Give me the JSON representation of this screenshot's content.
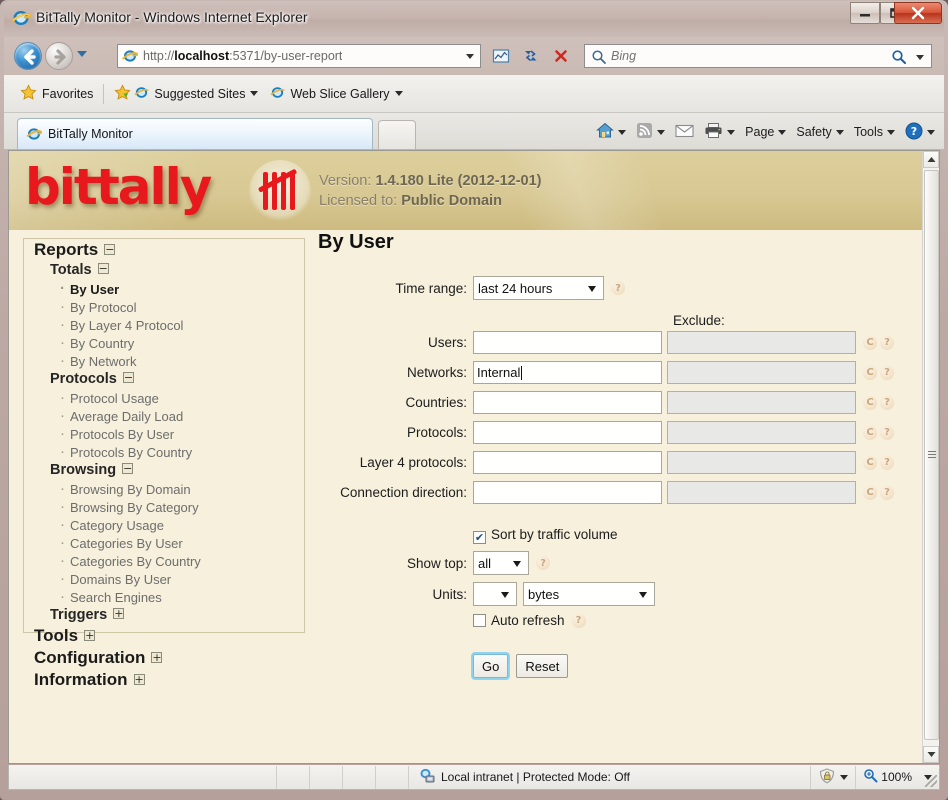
{
  "window": {
    "title": "BitTally Monitor - Windows Internet Explorer",
    "minimize_label": "Minimize",
    "maximize_label": "Maximize",
    "close_label": "Close"
  },
  "browser": {
    "url_prefix": "http://",
    "url_host": "localhost",
    "url_rest": ":5371/by-user-report",
    "search_placeholder": "Bing",
    "favorites_label": "Favorites",
    "suggested_sites_label": "Suggested Sites",
    "web_slice_label": "Web Slice Gallery",
    "tab_label": "BitTally Monitor",
    "commands": [
      {
        "label": "Page"
      },
      {
        "label": "Safety"
      },
      {
        "label": "Tools"
      }
    ]
  },
  "banner": {
    "logo": "bittally",
    "version_label": "Version:",
    "version_value": "1.4.180 Lite (2012-12-01)",
    "licensed_label": "Licensed to:",
    "licensed_value": "Public Domain"
  },
  "sidebar": {
    "groups": [
      {
        "label": "Reports",
        "toggle": "−",
        "subgroups": [
          {
            "label": "Totals",
            "toggle": "−",
            "items": [
              {
                "label": "By User",
                "active": true
              },
              {
                "label": "By Protocol",
                "active": false
              },
              {
                "label": "By Layer 4 Protocol",
                "active": false
              },
              {
                "label": "By Country",
                "active": false
              },
              {
                "label": "By Network",
                "active": false
              }
            ]
          },
          {
            "label": "Protocols",
            "toggle": "−",
            "items": [
              {
                "label": "Protocol Usage",
                "active": false
              },
              {
                "label": "Average Daily Load",
                "active": false
              },
              {
                "label": "Protocols By User",
                "active": false
              },
              {
                "label": "Protocols By Country",
                "active": false
              }
            ]
          },
          {
            "label": "Browsing",
            "toggle": "−",
            "items": [
              {
                "label": "Browsing By Domain",
                "active": false
              },
              {
                "label": "Browsing By Category",
                "active": false
              },
              {
                "label": "Category Usage",
                "active": false
              },
              {
                "label": "Categories By User",
                "active": false
              },
              {
                "label": "Categories By Country",
                "active": false
              },
              {
                "label": "Domains By User",
                "active": false
              },
              {
                "label": "Search Engines",
                "active": false
              }
            ]
          },
          {
            "label": "Triggers",
            "toggle": "+",
            "items": []
          }
        ]
      },
      {
        "label": "Tools",
        "toggle": "+",
        "subgroups": []
      },
      {
        "label": "Configuration",
        "toggle": "+",
        "subgroups": []
      },
      {
        "label": "Information",
        "toggle": "+",
        "subgroups": []
      }
    ]
  },
  "main": {
    "title": "By User",
    "time_range_label": "Time range:",
    "time_range_value": "last 24 hours",
    "exclude_header": "Exclude:",
    "filters": [
      {
        "label": "Users:",
        "value": "",
        "exclude": "",
        "focused": false
      },
      {
        "label": "Networks:",
        "value": "Internal",
        "exclude": "",
        "focused": true
      },
      {
        "label": "Countries:",
        "value": "",
        "exclude": "",
        "focused": false
      },
      {
        "label": "Protocols:",
        "value": "",
        "exclude": "",
        "focused": false
      },
      {
        "label": "Layer 4 protocols:",
        "value": "",
        "exclude": "",
        "focused": false
      },
      {
        "label": "Connection direction:",
        "value": "",
        "exclude": "",
        "focused": false
      }
    ],
    "clear_icon_glyph": "C",
    "help_icon_glyph": "?",
    "sort_checkbox_label": "Sort by traffic volume",
    "sort_checked": true,
    "show_top_label": "Show top:",
    "show_top_value": "all",
    "units_label": "Units:",
    "units_prefix_value": "",
    "units_value": "bytes",
    "auto_refresh_label": "Auto refresh",
    "auto_refresh_checked": false,
    "go_label": "Go",
    "reset_label": "Reset"
  },
  "statusbar": {
    "zone": "Local intranet | Protected Mode: Off",
    "zoom": "100%"
  }
}
